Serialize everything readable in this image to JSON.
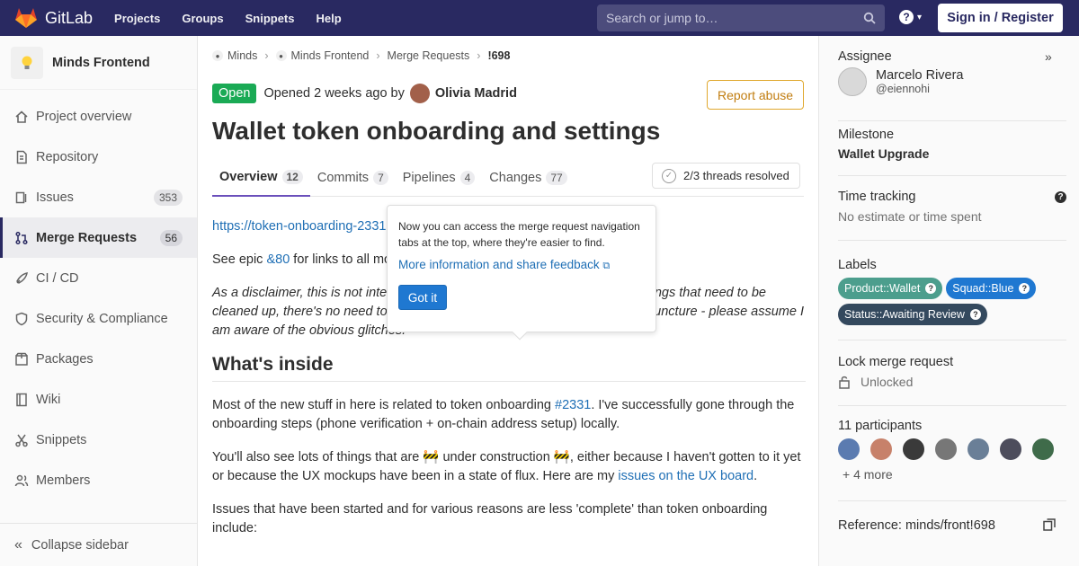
{
  "nav": {
    "brand": "GitLab",
    "links": [
      "Projects",
      "Groups",
      "Snippets",
      "Help"
    ],
    "search_placeholder": "Search or jump to…",
    "help_glyph": "?",
    "signin": "Sign in / Register"
  },
  "sidebar": {
    "project_name": "Minds Frontend",
    "items": [
      {
        "label": "Project overview",
        "icon": "home-icon",
        "count": ""
      },
      {
        "label": "Repository",
        "icon": "doc-icon",
        "count": ""
      },
      {
        "label": "Issues",
        "icon": "issues-icon",
        "count": "353"
      },
      {
        "label": "Merge Requests",
        "icon": "merge-icon",
        "count": "56"
      },
      {
        "label": "CI / CD",
        "icon": "rocket-icon",
        "count": ""
      },
      {
        "label": "Security & Compliance",
        "icon": "shield-icon",
        "count": ""
      },
      {
        "label": "Packages",
        "icon": "package-icon",
        "count": ""
      },
      {
        "label": "Wiki",
        "icon": "book-icon",
        "count": ""
      },
      {
        "label": "Snippets",
        "icon": "scissors-icon",
        "count": ""
      },
      {
        "label": "Members",
        "icon": "users-icon",
        "count": ""
      }
    ],
    "collapse": "Collapse sidebar"
  },
  "main": {
    "breadcrumbs": [
      "Minds",
      "Minds Frontend",
      "Merge Requests",
      "!698"
    ],
    "status": "Open",
    "opened_text": "Opened 2 weeks ago by",
    "author": "Olivia Madrid",
    "report": "Report abuse",
    "title": "Wallet token onboarding and settings",
    "tabs": [
      {
        "label": "Overview",
        "count": "12"
      },
      {
        "label": "Commits",
        "count": "7"
      },
      {
        "label": "Pipelines",
        "count": "4"
      },
      {
        "label": "Changes",
        "count": "77"
      }
    ],
    "threads": "2/3 threads resolved",
    "body": {
      "link1": "https://token-onboarding-2331",
      "epic_pre": "See epic ",
      "epic_link": "&80",
      "epic_post": " for links to all mo",
      "disclaimer_l1": "As a disclaimer, this is not inter",
      "disclaimer_l1b": "ngs that need to be",
      "disclaimer_l2": "cleaned up, there's no need to",
      "disclaimer_l2b": "uncture - please assume I",
      "disclaimer_l3": "am aware of the obvious glitches.",
      "h2": "What's inside",
      "p1_pre": "Most of the new stuff in here is related to token onboarding ",
      "p1_link": "#2331",
      "p1_post": ". I've successfully gone through the onboarding steps (phone verification + on-chain address setup) locally.",
      "p2_pre": "You'll also see lots of things that are 🚧 under construction 🚧, either because I haven't gotten to it yet or because the UX mockups have been in a state of flux. Here are my ",
      "p2_link": "issues on the UX board",
      "p2_post": ".",
      "p3": "Issues that have been started and for various reasons are less 'complete' than token onboarding include:"
    }
  },
  "popover": {
    "text": "Now you can access the merge request navigation tabs at the top, where they're easier to find.",
    "link": "More information and share feedback",
    "button": "Got it"
  },
  "right": {
    "assignee_label": "Assignee",
    "assignee_name": "Marcelo Rivera",
    "assignee_user": "@eiennohi",
    "milestone_label": "Milestone",
    "milestone": "Wallet Upgrade",
    "time_label": "Time tracking",
    "time_value": "No estimate or time spent",
    "labels_label": "Labels",
    "labels": [
      {
        "text": "Product::Wallet",
        "color": "#4c9e8d"
      },
      {
        "text": "Squad::Blue",
        "color": "#1f78d1"
      },
      {
        "text": "Status::Awaiting Review",
        "color": "#34495e"
      }
    ],
    "lock_label": "Lock merge request",
    "lock_value": "Unlocked",
    "participants_label": "11 participants",
    "participants_more": "+ 4 more",
    "reference": "Reference: minds/front!698"
  }
}
